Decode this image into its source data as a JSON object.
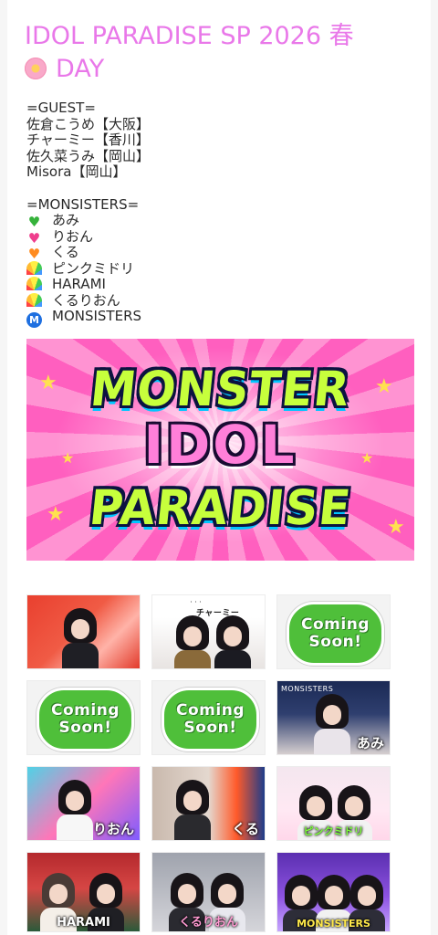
{
  "title": "IDOL PARADISE SP 2026 春",
  "subtitle": "DAY",
  "guest_header": "=GUEST=",
  "guests": [
    "佐倉こうめ【大阪】",
    "チャーミー【香川】",
    "佐久菜うみ【岡山】",
    "Misora【岡山】"
  ],
  "monsisters_header": "=MONSISTERS=",
  "monsisters": [
    {
      "icon": "green-heart-icon",
      "label": "あみ"
    },
    {
      "icon": "pink-heart-icon",
      "label": "りおん"
    },
    {
      "icon": "orange-heart-icon",
      "label": "くる"
    },
    {
      "icon": "rainbow-icon",
      "label": "ピンクミドリ"
    },
    {
      "icon": "rainbow-icon",
      "label": "HARAMI"
    },
    {
      "icon": "rainbow-icon",
      "label": "くるりおん"
    },
    {
      "icon": "metro-m-icon",
      "label": "MONSISTERS"
    }
  ],
  "banner": {
    "line1": "MONSTER",
    "line2": "IDOL",
    "line3": "PARADISE"
  },
  "tiles": [
    {
      "kind": "photo",
      "caption": ""
    },
    {
      "kind": "photo",
      "caption": "チャーミー"
    },
    {
      "kind": "coming",
      "line1": "Coming",
      "line2": "Soon!"
    },
    {
      "kind": "coming",
      "line1": "Coming",
      "line2": "Soon!"
    },
    {
      "kind": "coming",
      "line1": "Coming",
      "line2": "Soon!"
    },
    {
      "kind": "photo",
      "topcap": "MONSISTERS",
      "caption": "あみ"
    },
    {
      "kind": "photo",
      "caption": "りおん"
    },
    {
      "kind": "photo",
      "caption": "くる"
    },
    {
      "kind": "photo",
      "caption": "ピンクミドリ"
    },
    {
      "kind": "photo",
      "caption": "HARAMI"
    },
    {
      "kind": "photo",
      "caption": "くるりおん"
    },
    {
      "kind": "photo",
      "caption": "MONSISTERS"
    }
  ],
  "colors": {
    "title": "#e978e9",
    "coming_green": "#4fbf3a",
    "banner_pink": "#ff5fbf"
  }
}
